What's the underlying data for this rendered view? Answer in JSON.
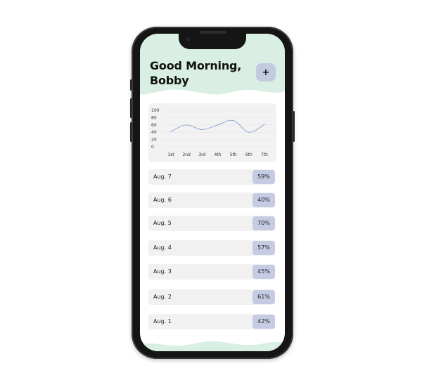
{
  "header": {
    "greeting_line1": "Good Morning,",
    "greeting_line2": "Bobby",
    "add_label": "+"
  },
  "chart_data": {
    "type": "line",
    "categories": [
      "1st",
      "2nd",
      "3rd",
      "4th",
      "5th",
      "6th",
      "7th"
    ],
    "values": [
      42,
      60,
      47,
      60,
      72,
      40,
      61
    ],
    "y_ticks": [
      "100",
      "80",
      "60",
      "40",
      "20",
      "0"
    ],
    "ylim": [
      0,
      100
    ],
    "grid": true,
    "line_color": "#8fa2d8"
  },
  "days": [
    {
      "label": "Aug. 7",
      "value": "59%"
    },
    {
      "label": "Aug. 6",
      "value": "40%"
    },
    {
      "label": "Aug. 5",
      "value": "70%"
    },
    {
      "label": "Aug. 4",
      "value": "57%"
    },
    {
      "label": "Aug. 3",
      "value": "45%"
    },
    {
      "label": "Aug. 2",
      "value": "61%"
    },
    {
      "label": "Aug. 1",
      "value": "42%"
    }
  ],
  "colors": {
    "header_wave": "#d9efe3",
    "accent": "#c5cbe3",
    "card_bg": "#f2f2f2"
  }
}
